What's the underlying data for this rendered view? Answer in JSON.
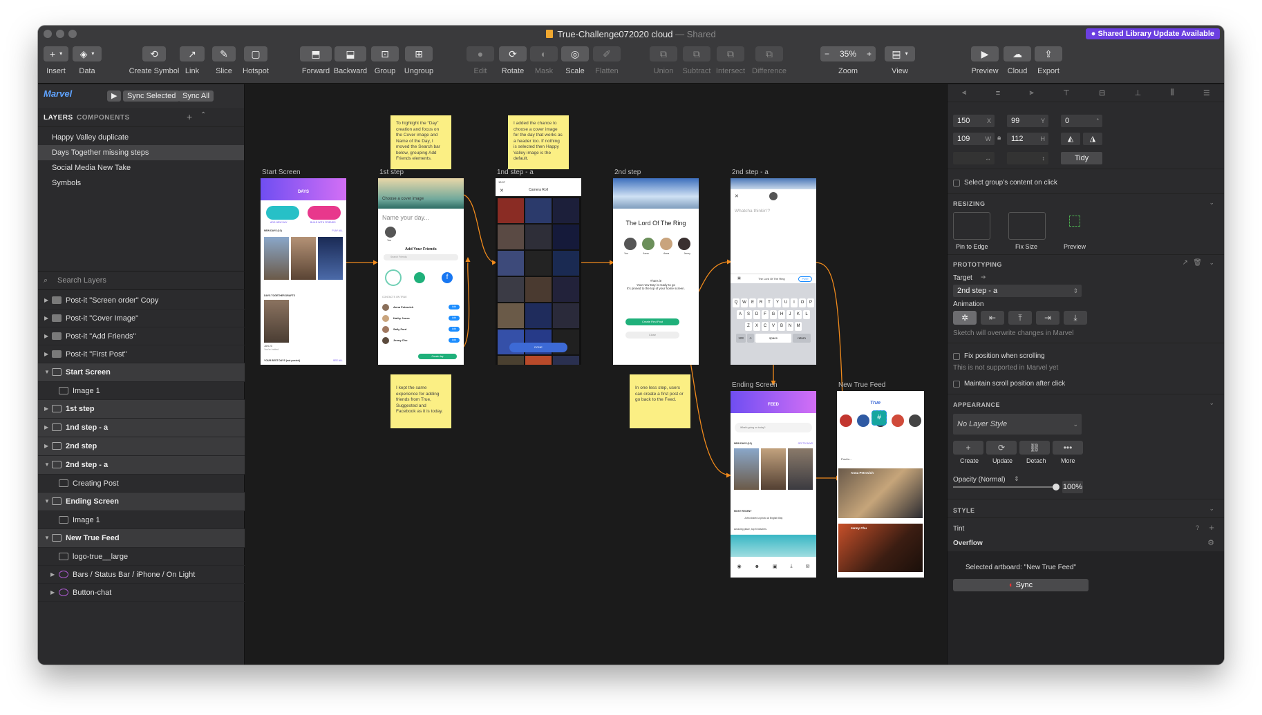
{
  "window": {
    "title": "True-Challenge072020 cloud",
    "shared": "— Shared",
    "badge": "Shared Library Update Available"
  },
  "toolbar": {
    "insert": "Insert",
    "data": "Data",
    "create_symbol": "Create Symbol",
    "link": "Link",
    "slice": "Slice",
    "hotspot": "Hotspot",
    "forward": "Forward",
    "backward": "Backward",
    "group": "Group",
    "ungroup": "Ungroup",
    "edit": "Edit",
    "rotate": "Rotate",
    "mask": "Mask",
    "scale": "Scale",
    "flatten": "Flatten",
    "union": "Union",
    "subtract": "Subtract",
    "intersect": "Intersect",
    "difference": "Difference",
    "zoom": "Zoom",
    "zoom_value": "35%",
    "view": "View",
    "preview": "Preview",
    "cloud": "Cloud",
    "export": "Export"
  },
  "left": {
    "marvel": "Marvel",
    "sync_selected": "Sync Selected",
    "sync_all": "Sync All",
    "tab_layers": "LAYERS",
    "tab_components": "COMPONENTS",
    "pages": [
      "Happy Valley duplicate",
      "Days Together missing steps",
      "Social Media New Take",
      "Symbols"
    ],
    "search_placeholder": "Search Layers",
    "layers": [
      {
        "label": "Post-it \"Screen order\" Copy"
      },
      {
        "label": "Post-it \"Cover Image\""
      },
      {
        "label": "Post-it \"Add Friends\""
      },
      {
        "label": "Post-it \"First Post\""
      },
      {
        "label": "Start Screen"
      },
      {
        "label": "Image 1"
      },
      {
        "label": "1st step"
      },
      {
        "label": "1nd step - a"
      },
      {
        "label": "2nd step"
      },
      {
        "label": "2nd step - a"
      },
      {
        "label": "Creating Post"
      },
      {
        "label": "Ending Screen"
      },
      {
        "label": "Image 1"
      },
      {
        "label": "New True Feed"
      },
      {
        "label": "logo-true__large"
      },
      {
        "label": "Bars / Status Bar / iPhone / On Light"
      },
      {
        "label": "Button-chat"
      }
    ]
  },
  "canvas": {
    "artboards": {
      "start": "Start Screen",
      "step1": "1st step",
      "step1a": "1nd step - a",
      "step2": "2nd step",
      "step2a": "2nd step - a",
      "ending": "Ending Screen",
      "feed": "New True Feed"
    },
    "notes": {
      "n1": "To highlight the “Day” creation and focus on the Cover image and Name of the Day, I moved the Search bar below, grouping Add Friends elements.",
      "n2": "I added the chance to choose a cover image for the day that works as a header too. If nothing is selected then Happy Valley image is the default.",
      "n3": "I kept the same experience for adding friends from True, Suggested and Facebook as it is today.",
      "n4": "In one less step, users can create a first post or go back to the Feed."
    },
    "screens": {
      "days": "DAYS",
      "add_new_day": "ADD NEW DAY",
      "build_friends": "BUILD WITH FRIENDS",
      "new_days": "NEW DAYS (10)",
      "play_all": "PLAY ALL",
      "drafts": "DAYS TOGETHER DRAFTS",
      "jun": "JUN 23",
      "invited": "You're Invited",
      "best_days": "YOUR BEST DAYS (not posted)",
      "see_all": "SEE ALL",
      "choose_cover": "Choose a cover image",
      "name_day": "Name your day...",
      "you": "You",
      "add_friends": "Add Your Friends",
      "search_friends": "Search Friends",
      "contacts": "CONTACTS ON TRUE",
      "friends": [
        "Anna Petrovich",
        "Kathy Jones",
        "Sally Ford",
        "Jenny Chu"
      ],
      "add": "Add",
      "create_day": "Create day",
      "camera_roll": "Camera Roll",
      "done": "DONE",
      "time1": "9:41",
      "time2": "13:07",
      "lord": "The Lord Of The Ring",
      "friend_short": [
        "You",
        "Anna",
        "Anna",
        "Jenny"
      ],
      "thats_it": "That's it!",
      "ready": "Your new Day is ready to go",
      "pinned": "It's pinned to the top of your home screen.",
      "create_post": "Create First Post",
      "close": "Close",
      "whatcha": "Whatcha thinkin'?",
      "lord2": "The Lord Of The Ring",
      "post": "POST",
      "space": "space",
      "return": "return",
      "feed": "FEED",
      "whats_going": "What's going on today?",
      "go_to_days": "GO TO DAYS",
      "most_recent": "MOST RECENT",
      "john": "John shared a photo at English Bay",
      "amazing": "Amazing place, top 5 beaches.",
      "post_in": "Post in...",
      "anna": "Anna Petrovich",
      "jenny": "Jenny Chu",
      "true_logo": "True"
    },
    "keyboard_rows": [
      "QWERTYUIOP",
      "ASDFGHJKL",
      "ZXCVBNM"
    ]
  },
  "right": {
    "x": "150",
    "y": "99",
    "rot": "0",
    "w": "109",
    "h": "112",
    "tidy": "Tidy",
    "select_group": "Select group’s content on click",
    "resizing": "RESIZING",
    "pin_edge": "Pin to Edge",
    "fix_size": "Fix Size",
    "preview": "Preview",
    "prototyping": "PROTOTYPING",
    "target": "Target",
    "target_value": "2nd step - a",
    "animation": "Animation",
    "sketch_overwrite": "Sketch will overwrite changes in Marvel",
    "fix_position": "Fix position when scrolling",
    "not_supported": "This is not supported in Marvel yet",
    "maintain_scroll": "Maintain scroll position after click",
    "appearance": "APPEARANCE",
    "no_layer_style": "No Layer Style",
    "create": "Create",
    "update": "Update",
    "detach": "Detach",
    "more": "More",
    "opacity": "Opacity (Normal)",
    "opacity_value": "100%",
    "style": "STYLE",
    "tint": "Tint",
    "overflow": "Overflow",
    "selected_artboard": "Selected artboard: \"New True Feed\"",
    "sync": "Sync"
  },
  "colors": {
    "accent": "#6b3fe0",
    "sticky": "#fbef84",
    "link": "#f08a1c",
    "green": "#1fb07a",
    "marvel": "#5fa3ff"
  }
}
